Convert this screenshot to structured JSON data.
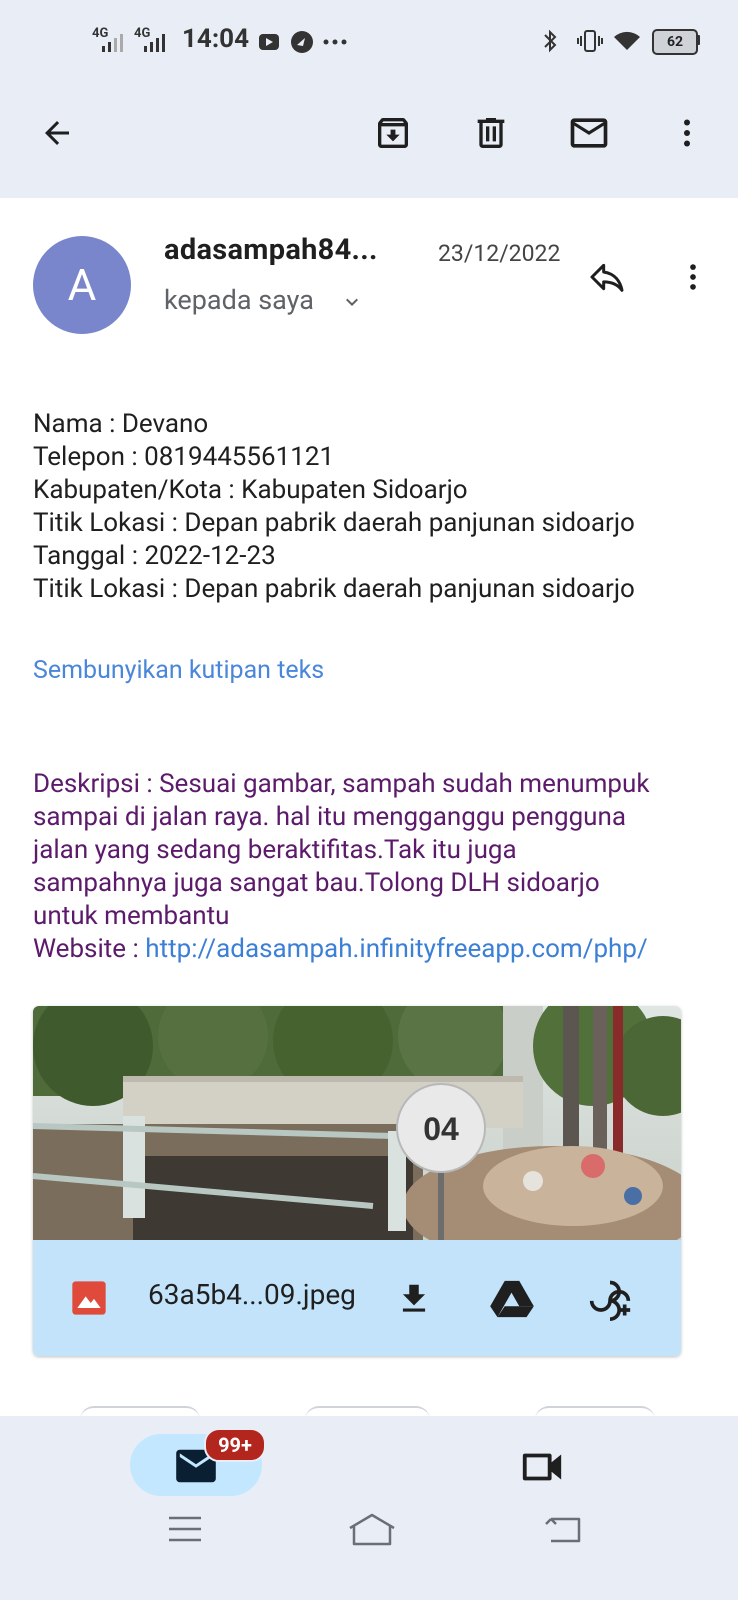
{
  "status_bar": {
    "network_1": "4G",
    "network_2": "4G",
    "time": "14:04",
    "battery": "62"
  },
  "email": {
    "avatar_letter": "A",
    "sender": "adasampah84...",
    "date": "23/12/2022",
    "recipient": "kepada saya",
    "body_lines": [
      "Nama : Devano",
      "Telepon : 0819445561121",
      "Kabupaten/Kota : Kabupaten Sidoarjo",
      "Titik Lokasi : Depan pabrik daerah panjunan sidoarjo",
      "Tanggal : 2022-12-23",
      "Titik Lokasi : Depan pabrik daerah panjunan sidoarjo"
    ],
    "hide_quoted": "Sembunyikan kutipan teks",
    "description_lines": [
      "Deskripsi : Sesuai gambar, sampah sudah menumpuk",
      "sampai di jalan raya. hal itu mengganggu pengguna",
      "jalan yang sedang beraktifitas.Tak itu juga",
      "sampahnya juga sangat bau.Tolong DLH sidoarjo",
      "untuk membantu"
    ],
    "website_label": "Website : ",
    "website_url": "http://adasampah.infinityfreeapp.com/php/",
    "attachment": {
      "filename": "63a5b4...09.jpeg",
      "photo_sign_number": "04"
    }
  },
  "bottom_nav": {
    "mail_badge": "99+"
  },
  "colors": {
    "header_bg": "#e9eef6",
    "avatar": "#7986cb",
    "link": "#4a86d9",
    "description_text": "#5c1a6b",
    "attachment_bar": "#c3e3fb",
    "badge": "#b3261e"
  }
}
